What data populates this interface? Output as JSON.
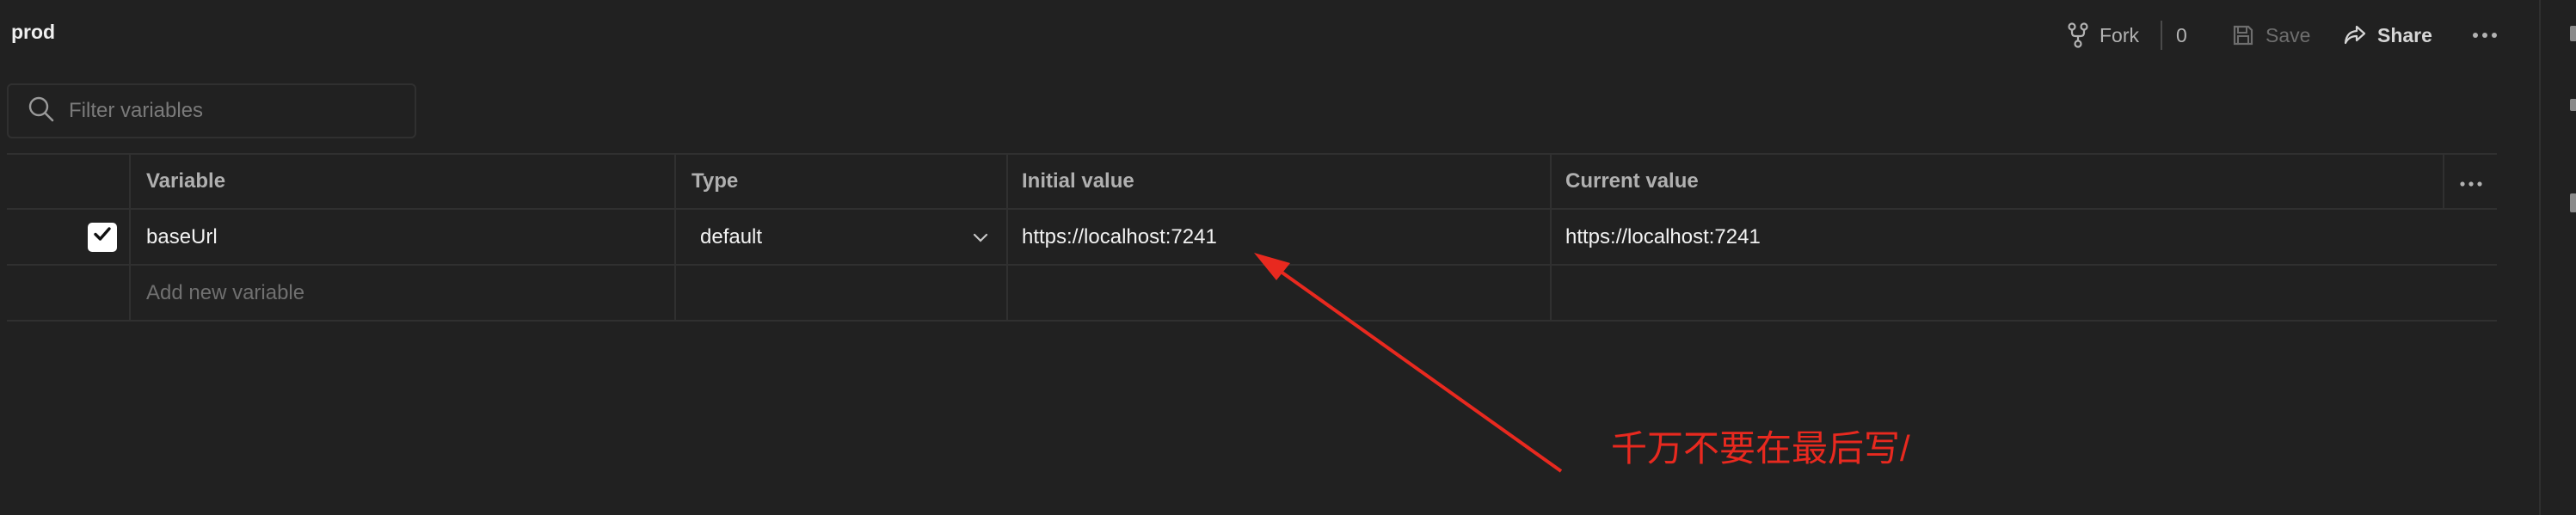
{
  "environment": {
    "title": "prod"
  },
  "toolbar": {
    "fork_label": "Fork",
    "fork_count": "0",
    "save_label": "Save",
    "share_label": "Share"
  },
  "filter": {
    "placeholder": "Filter variables",
    "value": ""
  },
  "table": {
    "columns": [
      "Variable",
      "Type",
      "Initial value",
      "Current value"
    ],
    "rows": [
      {
        "enabled": true,
        "variable": "baseUrl",
        "type": "default",
        "initial_value": "https://localhost:7241",
        "current_value": "https://localhost:7241"
      }
    ],
    "add_placeholder": "Add new variable"
  },
  "annotation": {
    "text": "千万不要在最后写/",
    "color": "#e8291f"
  },
  "icons": {
    "fork": "fork-icon",
    "save": "save-icon",
    "share": "share-icon",
    "more": "more-horizontal-icon",
    "search": "search-icon",
    "check": "checkmark-icon",
    "dropdown": "chevron-down-icon"
  },
  "colors": {
    "background": "#212121",
    "border": "#303030",
    "text": "#f2f2f2",
    "muted": "#707070"
  }
}
